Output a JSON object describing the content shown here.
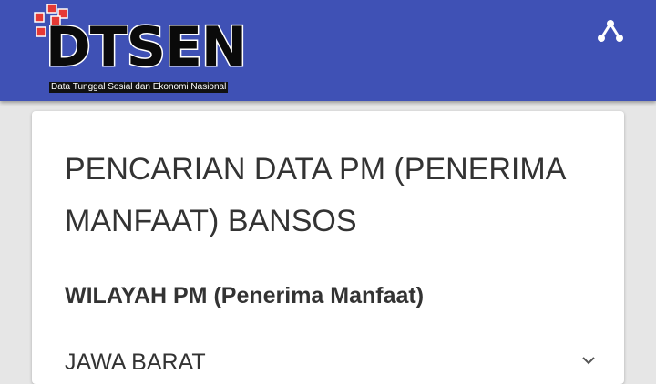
{
  "header": {
    "logo_text": "DTSEN",
    "logo_tagline": "Data Tunggal Sosial dan Ekonomi Nasional",
    "background_color": "#3f51b5",
    "menu_icon": "share-network-icon"
  },
  "form": {
    "title": "PENCARIAN DATA PM (PENERIMA MANFAAT) BANSOS",
    "region_label": "WILAYAH PM (Penerima Manfaat)",
    "province_select_value": "JAWA BARAT"
  }
}
